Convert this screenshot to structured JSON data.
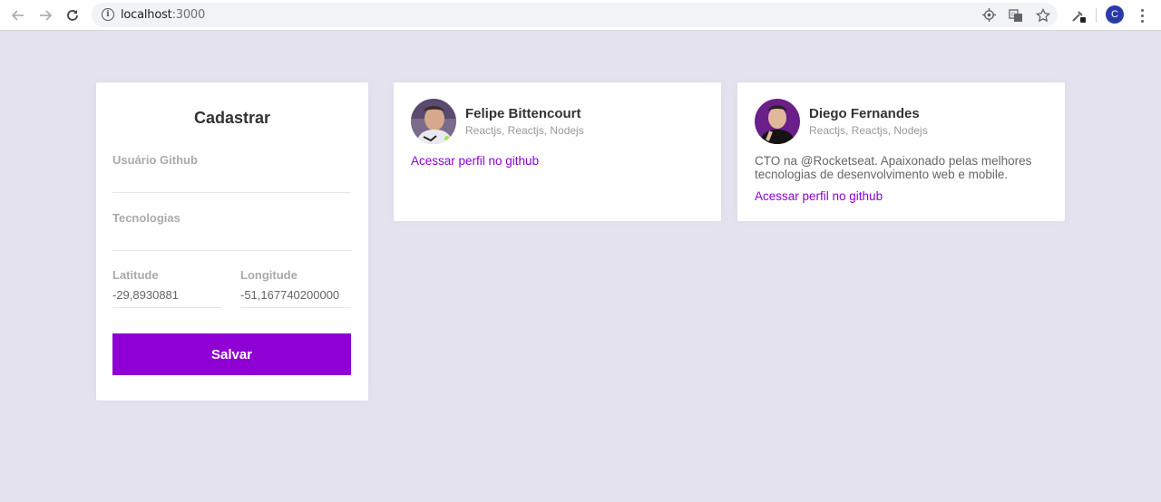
{
  "browser": {
    "url_host": "localhost",
    "url_port": ":3000",
    "profile_initial": "C"
  },
  "form": {
    "title": "Cadastrar",
    "github_label": "Usuário Github",
    "github_value": "",
    "techs_label": "Tecnologias",
    "techs_value": "",
    "latitude_label": "Latitude",
    "latitude_value": "-29,8930881",
    "longitude_label": "Longitude",
    "longitude_value": "-51,167740200000",
    "submit_label": "Salvar"
  },
  "devs": [
    {
      "name": "Felipe Bittencourt",
      "techs": "Reactjs, Reactjs, Nodejs",
      "bio": "",
      "link_label": "Acessar perfil no github"
    },
    {
      "name": "Diego Fernandes",
      "techs": "Reactjs, Reactjs, Nodejs",
      "bio": "CTO na @Rocketseat. Apaixonado pelas melhores tecnologias de desenvolvimento web e mobile.",
      "link_label": "Acessar perfil no github"
    }
  ],
  "colors": {
    "accent": "#8e00d4",
    "page_bg": "#e4e2ef"
  },
  "icons": {
    "back": "arrow-left-icon",
    "forward": "arrow-right-icon",
    "reload": "reload-icon",
    "info": "info-icon",
    "location": "location-target-icon",
    "translate": "translate-icon",
    "bookmark": "star-icon",
    "extension": "eyedropper-icon",
    "menu": "kebab-menu-icon"
  }
}
